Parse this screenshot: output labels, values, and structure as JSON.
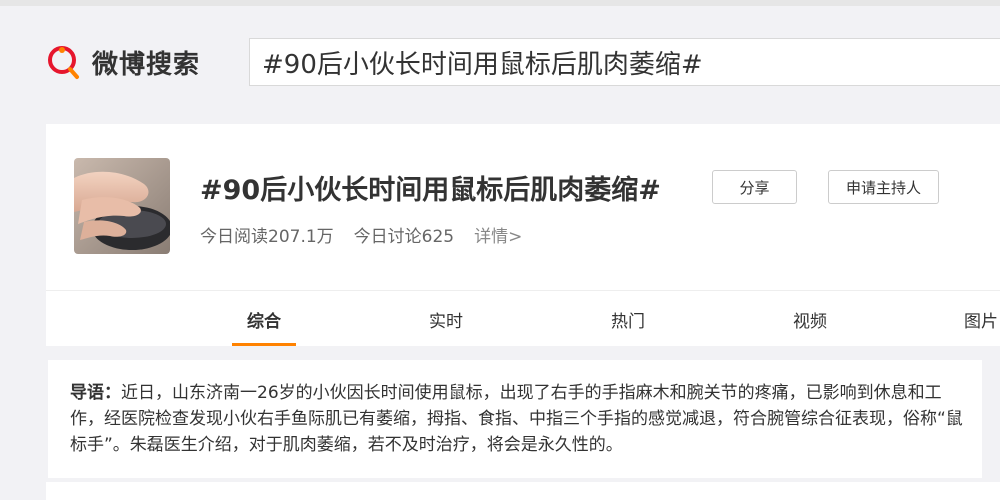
{
  "header": {
    "logo_text": "微博搜索",
    "search_value": "#90后小伙长时间用鼠标后肌肉萎缩#"
  },
  "topic": {
    "title": "#90后小伙长时间用鼠标后肌肉萎缩#",
    "reads": "今日阅读207.1万",
    "discussions": "今日讨论625",
    "details_link": "详情>",
    "share_label": "分享",
    "apply_host_label": "申请主持人"
  },
  "tabs": [
    {
      "label": "综合",
      "active": true
    },
    {
      "label": "实时",
      "active": false
    },
    {
      "label": "热门",
      "active": false
    },
    {
      "label": "视频",
      "active": false
    },
    {
      "label": "图片",
      "active": false
    }
  ],
  "intro": {
    "label": "导语：",
    "text": "近日，山东济南一26岁的小伙因长时间使用鼠标，出现了右手的手指麻木和腕关节的疼痛，已影响到休息和工作，经医院检查发现小伙右手鱼际肌已有萎缩，拇指、食指、中指三个手指的感觉减退，符合腕管综合征表现，俗称“鼠标手”。朱磊医生介绍，对于肌肉萎缩，若不及时治疗，将会是永久性的。"
  },
  "colors": {
    "accent": "#ff8200",
    "logo_red": "#e6162d",
    "background": "#f2f2f5"
  }
}
